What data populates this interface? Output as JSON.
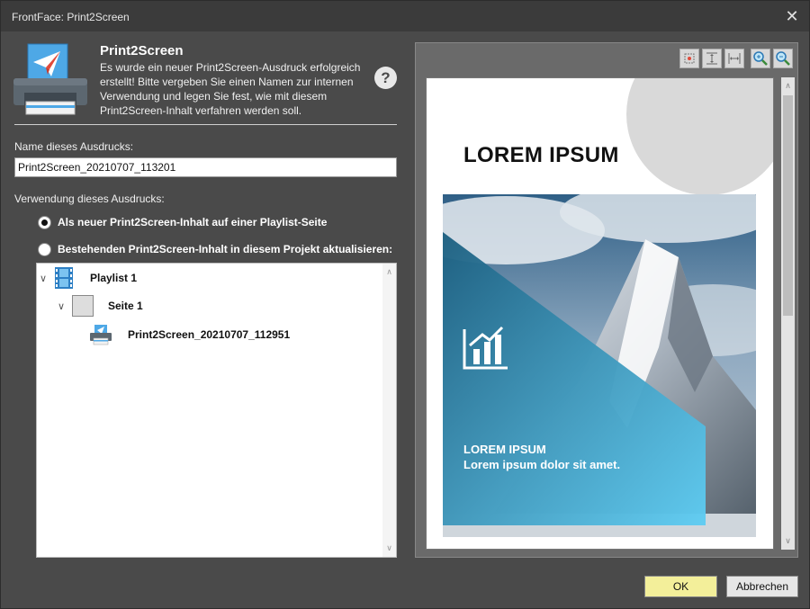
{
  "window": {
    "title": "FrontFace: Print2Screen",
    "close_glyph": "✕"
  },
  "header": {
    "icon": "printer-paperplane-icon",
    "title": "Print2Screen",
    "description": "Es wurde ein neuer Print2Screen-Ausdruck erfolgreich erstellt! Bitte vergeben Sie einen Namen zur internen Verwendung und legen Sie fest, wie mit diesem Print2Screen-Inhalt verfahren werden soll.",
    "help_glyph": "?"
  },
  "form": {
    "name_label": "Name dieses Ausdrucks:",
    "name_value": "Print2Screen_20210707_113201",
    "usage_label": "Verwendung dieses Ausdrucks:",
    "options": [
      {
        "label": "Als neuer Print2Screen-Inhalt auf einer Playlist-Seite",
        "checked": true
      },
      {
        "label": "Bestehenden Print2Screen-Inhalt in diesem Projekt aktualisieren:",
        "checked": false
      }
    ]
  },
  "tree": {
    "nodes": [
      {
        "label": "Playlist 1",
        "icon": "playlist-film-icon",
        "expanded": true
      },
      {
        "label": "Seite 1",
        "icon": "page-icon",
        "expanded": true
      },
      {
        "label": "Print2Screen_20210707_112951",
        "icon": "print2screen-item-icon"
      }
    ],
    "expand_glyph": "∨",
    "scroll_up": "∧",
    "scroll_down": "∨"
  },
  "preview": {
    "tools": [
      "fit-page-icon",
      "fit-height-icon",
      "fit-width-icon",
      "zoom-in-icon",
      "zoom-out-icon"
    ],
    "document": {
      "title": "LOREM IPSUM",
      "caption_title": "LOREM IPSUM",
      "caption_sub": "Lorem ipsum dolor sit amet."
    },
    "scroll_up": "∧",
    "scroll_down": "∨"
  },
  "buttons": {
    "ok": "OK",
    "cancel": "Abbrechen"
  },
  "colors": {
    "ok_button": "#f3ef9a",
    "overlay_start": "#2a6f8a",
    "overlay_end": "#5bc8ee"
  }
}
